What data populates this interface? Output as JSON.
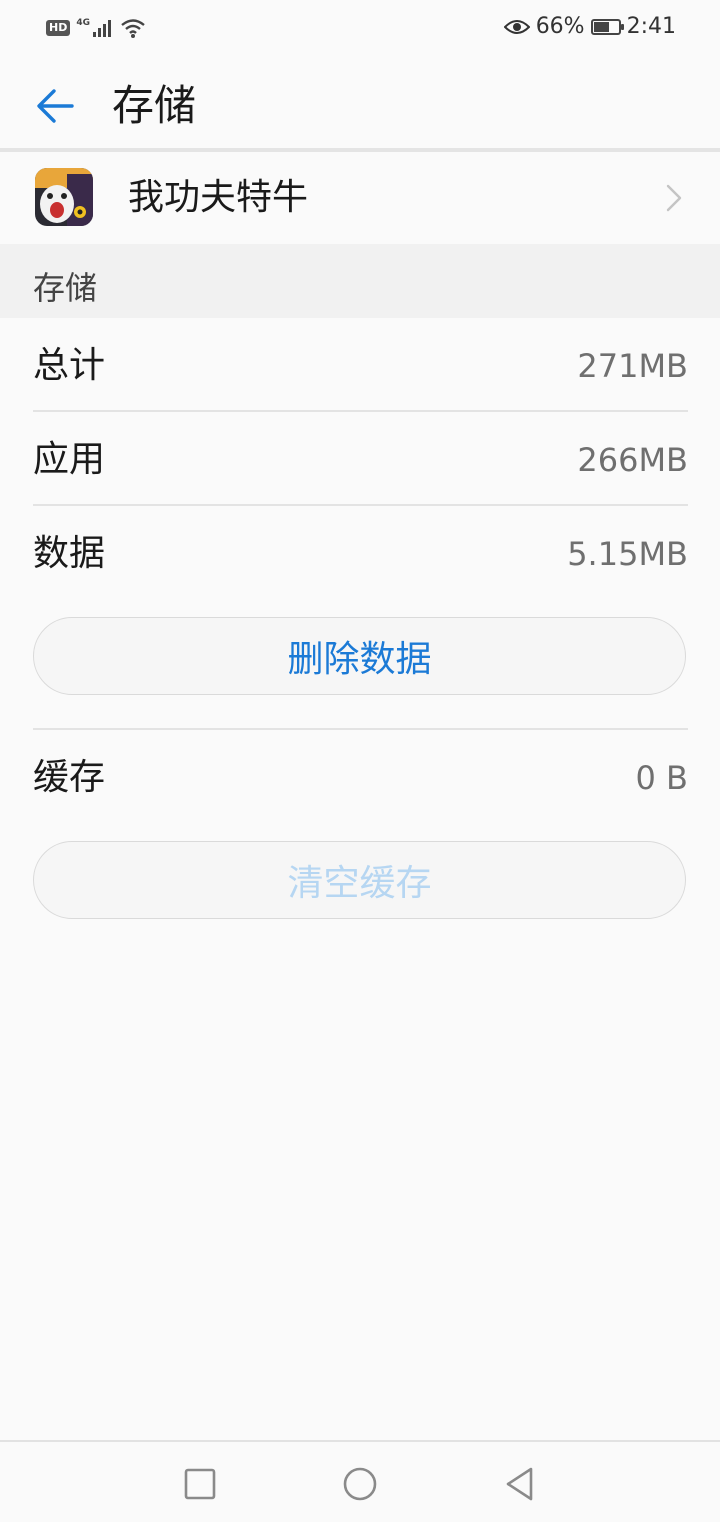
{
  "status_bar": {
    "hd_label": "HD",
    "network_label": "4G",
    "battery_text": "66%",
    "battery_level": 0.66,
    "time": "2:41"
  },
  "header": {
    "title": "存储",
    "back_icon": "arrow-left-icon"
  },
  "app": {
    "name": "我功夫特牛",
    "icon": "app-icon",
    "chevron_icon": "chevron-right-icon"
  },
  "storage_section": {
    "title": "存储",
    "rows": [
      {
        "label": "总计",
        "value": "271MB"
      },
      {
        "label": "应用",
        "value": "266MB"
      },
      {
        "label": "数据",
        "value": "5.15MB"
      }
    ],
    "delete_data_button": "删除数据",
    "cache_row": {
      "label": "缓存",
      "value": "0 B"
    },
    "clear_cache_button": "清空缓存"
  },
  "nav_bar": {
    "recent_icon": "square-icon",
    "home_icon": "circle-icon",
    "back_icon": "triangle-back-icon"
  },
  "colors": {
    "accent": "#1b7ad6",
    "accent_disabled": "#b6d6f2",
    "background": "#fafafa",
    "section_bg": "#f1f1f1"
  }
}
